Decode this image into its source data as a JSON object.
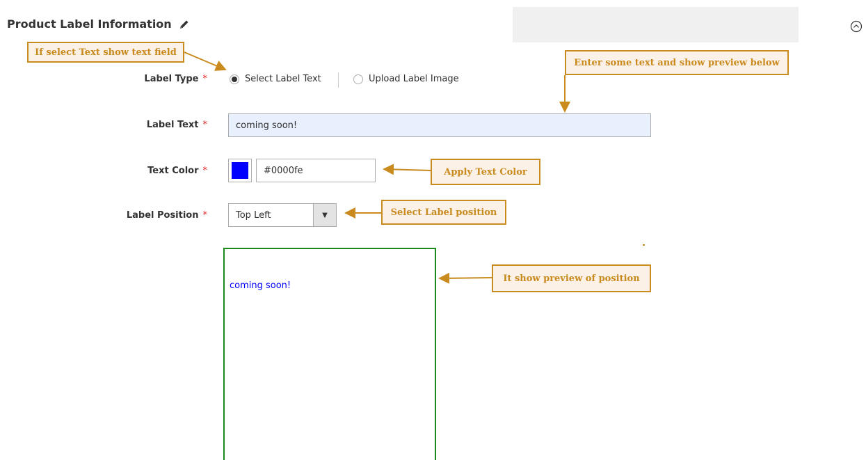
{
  "section": {
    "title": "Product Label Information"
  },
  "fields": {
    "label_type": {
      "label": "Label Type",
      "required_mark": "*",
      "options": [
        "Select Label Text",
        "Upload Label Image"
      ],
      "selected": "Select Label Text"
    },
    "label_text": {
      "label": "Label Text",
      "required_mark": "*",
      "value": "coming soon!"
    },
    "text_color": {
      "label": "Text Color",
      "required_mark": "*",
      "value": "#0000fe",
      "swatch_color": "#0000fe"
    },
    "label_position": {
      "label": "Label Position",
      "required_mark": "*",
      "value": "Top Left"
    }
  },
  "preview": {
    "text": "coming soon!",
    "text_color": "#0000fe",
    "border_color": "#1a8a1a"
  },
  "annotations": {
    "text_field": "If select Text show text field",
    "preview_below": "Enter some text and show preview below",
    "apply_color": "Apply Text Color",
    "select_position": "Select Label position",
    "preview_position": "It show preview of position"
  },
  "icons": {
    "edit": "pencil-icon",
    "collapse": "collapse-icon",
    "dropdown": "dropdown-arrow-icon"
  },
  "colors": {
    "annotation": "#c98a1e",
    "annotation_bg": "#fbf1e6",
    "required": "#e22626",
    "autofill_bg": "#e8f0fe"
  }
}
